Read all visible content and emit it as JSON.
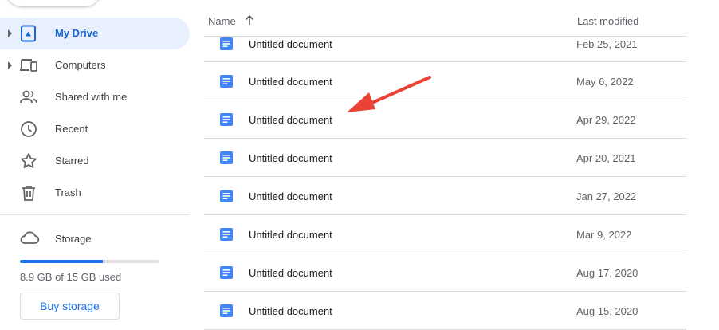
{
  "sidebar": {
    "items": [
      {
        "label": "My Drive",
        "icon": "my-drive-icon",
        "active": true,
        "expandable": true
      },
      {
        "label": "Computers",
        "icon": "computers-icon",
        "active": false,
        "expandable": true
      },
      {
        "label": "Shared with me",
        "icon": "shared-with-me-icon",
        "active": false,
        "expandable": false
      },
      {
        "label": "Recent",
        "icon": "clock-icon",
        "active": false,
        "expandable": false
      },
      {
        "label": "Starred",
        "icon": "star-icon",
        "active": false,
        "expandable": false
      },
      {
        "label": "Trash",
        "icon": "trash-icon",
        "active": false,
        "expandable": false
      }
    ],
    "storage": {
      "label": "Storage",
      "icon": "cloud-icon",
      "used_text": "8.9 GB of 15 GB used",
      "used_fraction": 0.593,
      "buy_label": "Buy storage"
    }
  },
  "file_list": {
    "header": {
      "name": "Name",
      "sort_icon": "arrow-up-icon",
      "last_modified": "Last modified"
    },
    "files": [
      {
        "name": "Untitled document",
        "modified": "Feb 25, 2021"
      },
      {
        "name": "Untitled document",
        "modified": "May 6, 2022"
      },
      {
        "name": "Untitled document",
        "modified": "Apr 29, 2022"
      },
      {
        "name": "Untitled document",
        "modified": "Apr 20, 2021"
      },
      {
        "name": "Untitled document",
        "modified": "Jan 27, 2022"
      },
      {
        "name": "Untitled document",
        "modified": "Mar 9, 2022"
      },
      {
        "name": "Untitled document",
        "modified": "Aug 17, 2020"
      },
      {
        "name": "Untitled document",
        "modified": "Aug 15, 2020"
      }
    ]
  },
  "colors": {
    "accent": "#1a73e8",
    "active_bg": "#e8f0fe",
    "doc_icon": "#4285f4",
    "annotation_arrow": "#ea4335"
  }
}
